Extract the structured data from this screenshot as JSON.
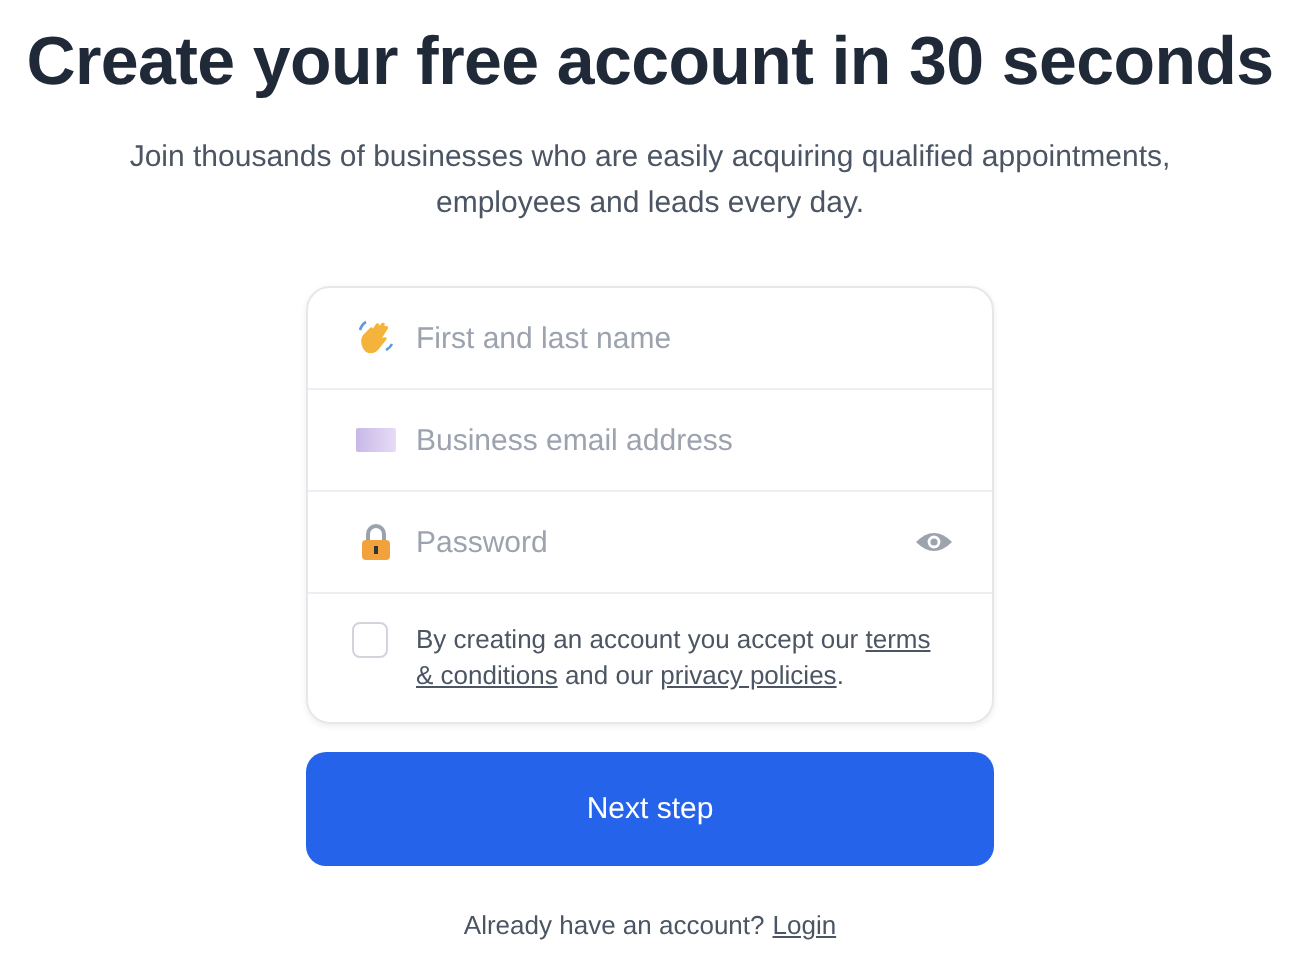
{
  "heading": "Create your free account in 30 seconds",
  "subtitle": "Join thousands of businesses who are easily acquiring qualified appointments, employees and leads every day.",
  "fields": [
    {
      "kind": "name",
      "placeholder": "First and last name"
    },
    {
      "kind": "email",
      "placeholder": "Business email address"
    },
    {
      "kind": "password",
      "placeholder": "Password"
    }
  ],
  "consent": {
    "checked": false,
    "text_before": "By creating an account you accept our ",
    "terms_link": "terms & conditions",
    "text_middle": " and our ",
    "privacy_link": "privacy policies",
    "text_after": "."
  },
  "submit_button": "Next step",
  "footer": {
    "text": "Already have an account?",
    "login_link": "Login"
  }
}
